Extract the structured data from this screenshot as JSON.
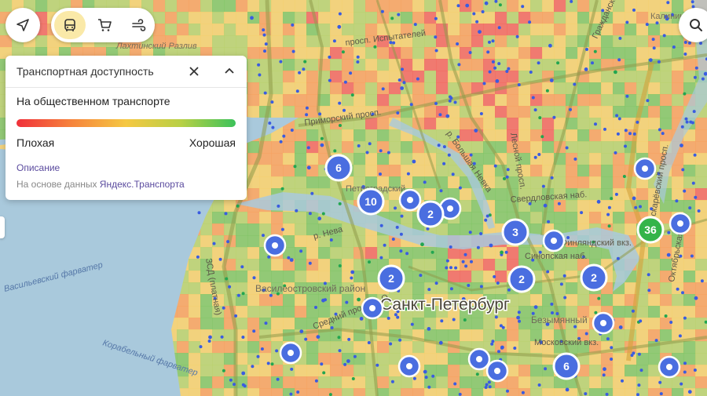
{
  "toolbar": {
    "nav_icon": "navigation-arrow-icon",
    "modes": [
      {
        "icon": "bus-icon",
        "active": true
      },
      {
        "icon": "cart-icon",
        "active": false
      },
      {
        "icon": "wind-icon",
        "active": false
      }
    ],
    "search_icon": "search-icon"
  },
  "panel": {
    "title": "Транспортная доступность",
    "subtitle": "На общественном транспорте",
    "bad_label": "Плохая",
    "good_label": "Хорошая",
    "description_link": "Описание",
    "source_prefix": "На основе данных",
    "source_link": "Яндекс.Транспорта",
    "gradient_colors": [
      "#f0303a",
      "#f6833c",
      "#f5c842",
      "#b8d045",
      "#3cc25a"
    ]
  },
  "map": {
    "city_label": "Санкт-Петербург",
    "place_labels": [
      {
        "text": "Лахтинский Разлив"
      },
      {
        "text": "Калинин район"
      },
      {
        "text": "Петроградский"
      },
      {
        "text": "Василеостровский район"
      },
      {
        "text": "Безымянный"
      }
    ],
    "street_labels": [
      {
        "text": "Приморский просп."
      },
      {
        "text": "просп. Испытателей"
      },
      {
        "text": "р. Большая Невка"
      },
      {
        "text": "Лесной просп."
      },
      {
        "text": "Гражданск."
      },
      {
        "text": "Пискарёвский просп."
      },
      {
        "text": "р. Нева"
      },
      {
        "text": "Свердловская наб."
      },
      {
        "text": "Октябрьская наб."
      },
      {
        "text": "Синопская наб."
      },
      {
        "text": "Московский вкз."
      },
      {
        "text": "Финляндский вкз."
      },
      {
        "text": "Средний просп. В.О."
      },
      {
        "text": "ЗСД (платная)"
      },
      {
        "text": "Васильевский фарватер"
      },
      {
        "text": "Корабельный фарватер"
      }
    ],
    "clusters": [
      {
        "count": "6"
      },
      {
        "count": "10"
      },
      {
        "count": "2"
      },
      {
        "count": "3"
      },
      {
        "count": "2"
      },
      {
        "count": "2"
      },
      {
        "count": "2"
      },
      {
        "count": "36"
      },
      {
        "count": "6"
      }
    ],
    "colors": {
      "bad": "#f2645a",
      "mid_bad": "#f7a05a",
      "mid": "#f4d06a",
      "good": "#b6d16a",
      "very_good": "#7fc562",
      "water": "#a9c9dc",
      "cluster": "#4a6ee0",
      "cluster_good": "#34b449",
      "stop": "#3a5ce0"
    }
  }
}
